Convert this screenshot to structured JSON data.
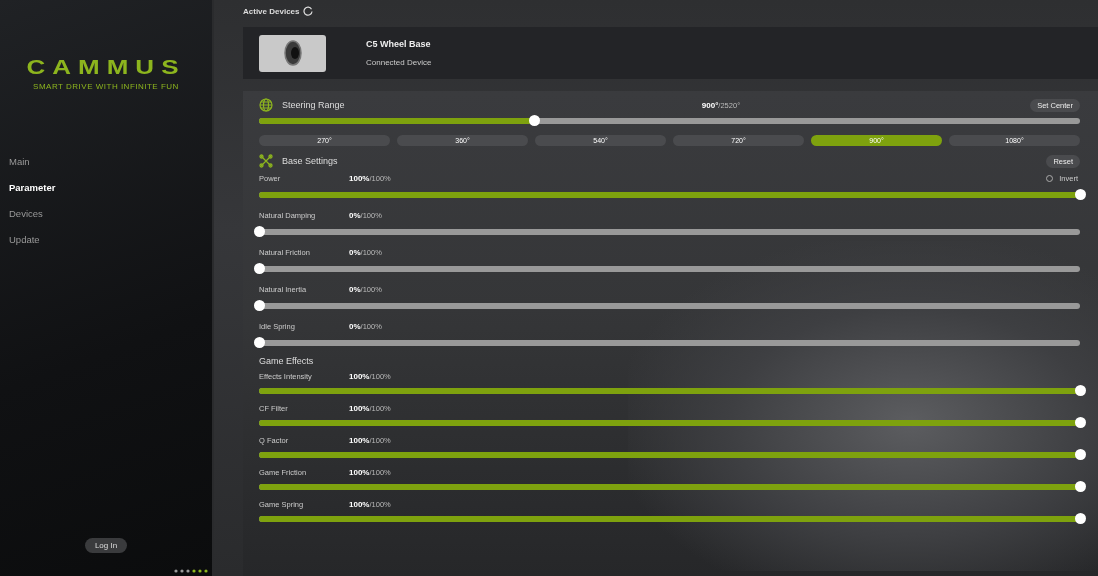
{
  "sidebar": {
    "logo": "CAMMUS",
    "tagline": "SMART DRIVE WITH INFINITE FUN",
    "nav": [
      {
        "label": "Main",
        "selected": false
      },
      {
        "label": "Parameter",
        "selected": true
      },
      {
        "label": "Devices",
        "selected": false
      },
      {
        "label": "Update",
        "selected": false
      }
    ],
    "login_button": "Log In"
  },
  "active_devices": {
    "title": "Active Devices",
    "device": {
      "name": "C5 Wheel Base",
      "status": "Connected Device"
    }
  },
  "steering": {
    "title": "Steering Range",
    "value": "900°",
    "max": "/2520°",
    "level": 0.335,
    "set_center": "Set Center",
    "presets": [
      {
        "label": "270°",
        "selected": false
      },
      {
        "label": "360°",
        "selected": false
      },
      {
        "label": "540°",
        "selected": false
      },
      {
        "label": "720°",
        "selected": false
      },
      {
        "label": "900°",
        "selected": true
      },
      {
        "label": "1080°",
        "selected": false
      }
    ]
  },
  "base_settings": {
    "title": "Base Settings",
    "reset": "Reset",
    "invert": {
      "label": "Invert",
      "checked": false
    },
    "sliders": [
      {
        "name": "Power",
        "value": "100%",
        "max": "/100%",
        "level": 1
      },
      {
        "name": "Natural Damping",
        "value": "0%",
        "max": "/100%",
        "level": 0
      },
      {
        "name": "Natural Friction",
        "value": "0%",
        "max": "/100%",
        "level": 0
      },
      {
        "name": "Natural Inertia",
        "value": "0%",
        "max": "/100%",
        "level": 0
      },
      {
        "name": "Idle Spring",
        "value": "0%",
        "max": "/100%",
        "level": 0
      }
    ]
  },
  "game_effects": {
    "title": "Game Effects",
    "sliders": [
      {
        "name": "Effects Intensity",
        "value": "100%",
        "max": "/100%",
        "level": 1
      },
      {
        "name": "CF Filter",
        "value": "100%",
        "max": "/100%",
        "level": 1
      },
      {
        "name": "Q Factor",
        "value": "100%",
        "max": "/100%",
        "level": 1
      },
      {
        "name": "Game Friction",
        "value": "100%",
        "max": "/100%",
        "level": 1
      },
      {
        "name": "Game Spring",
        "value": "100%",
        "max": "/100%",
        "level": 1
      }
    ]
  }
}
